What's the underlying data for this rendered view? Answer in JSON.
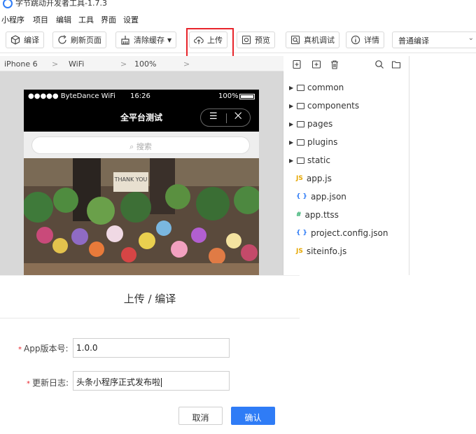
{
  "window": {
    "title": "字节跳动开发者工具-1.7.3"
  },
  "menu": [
    "小程序",
    "项目",
    "编辑",
    "工具",
    "界面",
    "设置"
  ],
  "toolbar": {
    "compile": "编译",
    "refresh": "刷新页面",
    "clear_cache": "清除缓存",
    "upload": "上传",
    "preview": "预览",
    "remote_debug": "真机调试",
    "details": "详情",
    "compile_mode": "普通编译"
  },
  "device_bar": {
    "device": "iPhone 6",
    "network": "WiFi",
    "zoom": "100%"
  },
  "simulator": {
    "carrier": "●●●●● ByteDance WiFi",
    "time": "16:26",
    "battery": "100%",
    "nav_title": "全平台测试",
    "search_placeholder": "搜索",
    "photo_sign": "THANK YOU"
  },
  "file_tree": [
    {
      "name": "common",
      "type": "folder"
    },
    {
      "name": "components",
      "type": "folder"
    },
    {
      "name": "pages",
      "type": "folder"
    },
    {
      "name": "plugins",
      "type": "folder"
    },
    {
      "name": "static",
      "type": "folder"
    },
    {
      "name": "app.js",
      "type": "js",
      "badge": "JS"
    },
    {
      "name": "app.json",
      "type": "json",
      "badge": "{ }"
    },
    {
      "name": "app.ttss",
      "type": "css",
      "badge": "#"
    },
    {
      "name": "project.config.json",
      "type": "json",
      "badge": "{ }"
    },
    {
      "name": "siteinfo.js",
      "type": "js",
      "badge": "JS"
    }
  ],
  "dialog": {
    "title": "上传 / 编译",
    "version_label": "App版本号:",
    "version_value": "1.0.0",
    "log_label": "更新日志:",
    "log_value": "头条小程序正式发布啦",
    "cancel": "取消",
    "confirm": "确认"
  },
  "colors": {
    "accent": "#2f7cf6",
    "highlight": "#e8252c",
    "json_icon": "#2f7cf6",
    "js_icon": "#e6a700",
    "css_icon": "#20a862"
  }
}
